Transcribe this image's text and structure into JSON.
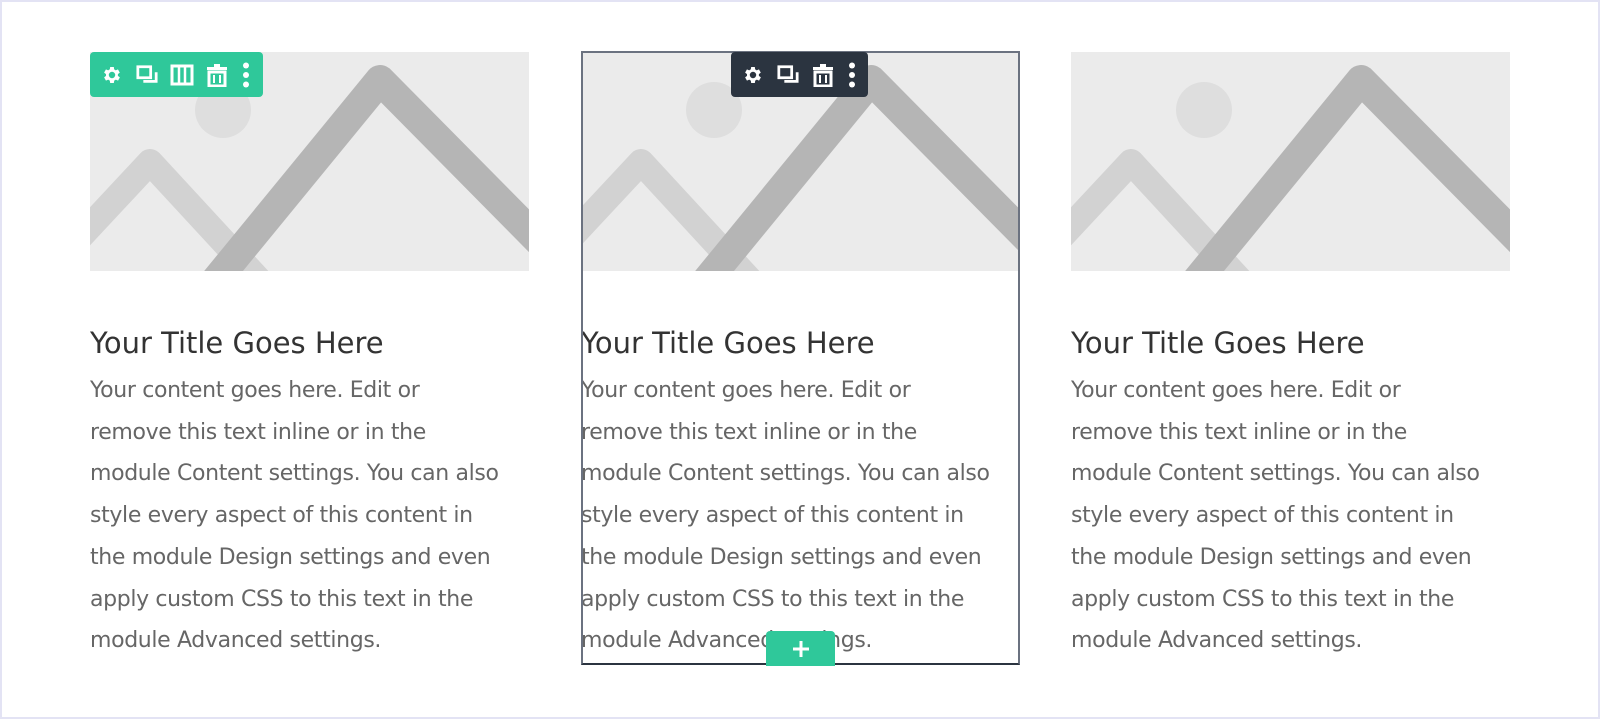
{
  "modules": [
    {
      "title": "Your Title Goes Here",
      "lines": [
        "Your content goes here. Edit or",
        "remove this text inline or in the",
        "module Content settings. You can also",
        "style every aspect of this content in",
        "the module Design settings and even",
        "apply custom CSS to this text in the",
        "module Advanced settings."
      ]
    },
    {
      "title": "Your Title Goes Here",
      "lines": [
        "Your content goes here. Edit or",
        "remove this text inline or in the",
        "module Content settings. You can also",
        "style every aspect of this content in",
        "the module Design settings and even",
        "apply custom CSS to this text in the",
        "module Advanced settings."
      ]
    },
    {
      "title": "Your Title Goes Here",
      "lines": [
        "Your content goes here. Edit or",
        "remove this text inline or in the",
        "module Content settings. You can also",
        "style every aspect of this content in",
        "the module Design settings and even",
        "apply custom CSS to this text in the",
        "module Advanced settings."
      ]
    }
  ],
  "row_toolbar": {
    "color": "#2fc89a",
    "icons": [
      "gear-icon",
      "duplicate-icon",
      "columns-icon",
      "trash-icon",
      "more-vertical-icon"
    ]
  },
  "module_toolbar": {
    "color": "#2b3440",
    "icons": [
      "gear-icon",
      "duplicate-icon",
      "trash-icon",
      "more-vertical-icon"
    ]
  },
  "add_button": {
    "icon": "plus-icon",
    "glyph": "+",
    "color": "#2fc89a"
  }
}
